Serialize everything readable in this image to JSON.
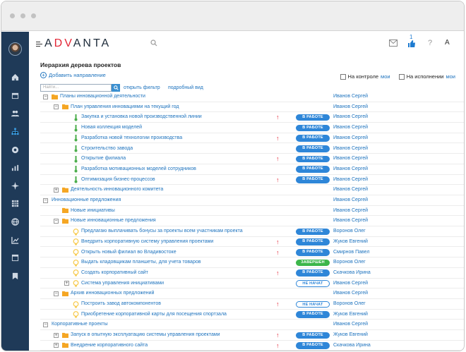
{
  "app": {
    "logo_prefix": "A",
    "logo_v": "DV",
    "logo_rest": "ANTA",
    "notif_count": "1"
  },
  "page": {
    "title": "Иерархия дерева проектов",
    "add_direction": "Добавить направление",
    "search_placeholder": "Найти...",
    "open_filter": "открыть фильтр",
    "detailed_view": "подробный вид",
    "on_control_label": "На контроле",
    "on_control_link": "мои",
    "on_execution_label": "На исполнении",
    "on_execution_link": "мои"
  },
  "colors": {
    "sidebar": "#1f3a58",
    "link": "#1e73be",
    "in_work": "#2e86d8",
    "done": "#3cb64a",
    "flag": "#e32636",
    "folder": "#f5a623",
    "idea": "#f7c948",
    "task": "#4cae4c"
  },
  "rows": [
    {
      "level": 0,
      "tog": "−",
      "icon": "folder",
      "name": "Планы инновационной деятельности",
      "flag": false,
      "status": "",
      "resp": "Иванов Сергей"
    },
    {
      "level": 1,
      "tog": "−",
      "icon": "folder",
      "name": "План управления инновациями на текущий год",
      "flag": false,
      "status": "",
      "resp": "Иванов Сергей"
    },
    {
      "level": 2,
      "tog": "",
      "icon": "task",
      "name": "Закупка и установка новой производственной линии",
      "flag": true,
      "status": "В РАБОТЕ",
      "resp": "Иванов Сергей"
    },
    {
      "level": 2,
      "tog": "",
      "icon": "task",
      "name": "Новая коллекция моделей",
      "flag": false,
      "status": "В РАБОТЕ",
      "resp": "Иванов Сергей"
    },
    {
      "level": 2,
      "tog": "",
      "icon": "task",
      "name": "Разработка новой технологии производства",
      "flag": true,
      "status": "В РАБОТЕ",
      "resp": "Иванов Сергей"
    },
    {
      "level": 2,
      "tog": "",
      "icon": "task",
      "name": "Строительство завода",
      "flag": false,
      "status": "В РАБОТЕ",
      "resp": "Иванов Сергей"
    },
    {
      "level": 2,
      "tog": "",
      "icon": "task",
      "name": "Открытие филиала",
      "flag": true,
      "status": "В РАБОТЕ",
      "resp": "Иванов Сергей"
    },
    {
      "level": 2,
      "tog": "",
      "icon": "task",
      "name": "Разработка мотивационных моделей сотрудников",
      "flag": false,
      "status": "В РАБОТЕ",
      "resp": "Иванов Сергей"
    },
    {
      "level": 2,
      "tog": "",
      "icon": "task",
      "name": "Оптимизация бизнес-процессов",
      "flag": true,
      "status": "В РАБОТЕ",
      "resp": "Иванов Сергей"
    },
    {
      "level": 1,
      "tog": "+",
      "icon": "folder",
      "name": "Деятельность инновационного комитета",
      "flag": false,
      "status": "",
      "resp": "Иванов Сергей"
    },
    {
      "level": 0,
      "tog": "−",
      "icon": "",
      "name": "Инновационные предложения",
      "flag": false,
      "status": "",
      "resp": "Иванов Сергей"
    },
    {
      "level": 1,
      "tog": "",
      "icon": "folder",
      "name": "Новые инициативы",
      "flag": false,
      "status": "",
      "resp": "Иванов Сергей"
    },
    {
      "level": 1,
      "tog": "−",
      "icon": "folder",
      "name": "Новые инновационные предложения",
      "flag": false,
      "status": "",
      "resp": "Иванов Сергей"
    },
    {
      "level": 2,
      "tog": "",
      "icon": "idea",
      "name": "Предлагаю выплачивать бонусы за проекты всем участникам проекта",
      "flag": false,
      "status": "В РАБОТЕ",
      "resp": "Воронов Олег"
    },
    {
      "level": 2,
      "tog": "",
      "icon": "idea",
      "name": "Внедрить корпоративную систему управления проектами",
      "flag": true,
      "status": "В РАБОТЕ",
      "resp": "Жуков Евгений"
    },
    {
      "level": 2,
      "tog": "",
      "icon": "idea",
      "name": "Открыть новый филиал во Владивостоке",
      "flag": true,
      "status": "В РАБОТЕ",
      "resp": "Смирнов Павел"
    },
    {
      "level": 2,
      "tog": "",
      "icon": "idea",
      "name": "Выдать кладовщикам планшеты, для учета товаров",
      "flag": false,
      "status": "ЗАВЕРШЕН",
      "resp": "Воронов Олег"
    },
    {
      "level": 2,
      "tog": "",
      "icon": "idea",
      "name": "Создать корпоративный сайт",
      "flag": true,
      "status": "В РАБОТЕ",
      "resp": "Скачкова Ирина"
    },
    {
      "level": 2,
      "tog": "+",
      "icon": "idea",
      "name": "Система управления инициативами",
      "flag": false,
      "status": "НЕ НАЧАТ",
      "resp": "Иванов Сергей"
    },
    {
      "level": 1,
      "tog": "−",
      "icon": "folder",
      "name": "Архив инновационных предложений",
      "flag": false,
      "status": "",
      "resp": "Иванов Сергей"
    },
    {
      "level": 2,
      "tog": "",
      "icon": "idea",
      "name": "Построить завод автокомпонентов",
      "flag": true,
      "status": "НЕ НАЧАТ",
      "resp": "Воронов Олег"
    },
    {
      "level": 2,
      "tog": "",
      "icon": "idea",
      "name": "Приобретение корпоративной карты для посещения спортзала",
      "flag": false,
      "status": "В РАБОТЕ",
      "resp": "Жуков Евгений"
    },
    {
      "level": 0,
      "tog": "−",
      "icon": "",
      "name": "Корпоративные проекты",
      "flag": false,
      "status": "",
      "resp": "Иванов Сергей"
    },
    {
      "level": 1,
      "tog": "+",
      "icon": "folder",
      "name": "Запуск в опытную эксплуатацию системы управления проектами",
      "flag": true,
      "status": "В РАБОТЕ",
      "resp": "Жуков Евгений"
    },
    {
      "level": 1,
      "tog": "+",
      "icon": "folder",
      "name": "Внедрение корпоративного сайта",
      "flag": true,
      "status": "В РАБОТЕ",
      "resp": "Скачкова Ирина"
    }
  ]
}
